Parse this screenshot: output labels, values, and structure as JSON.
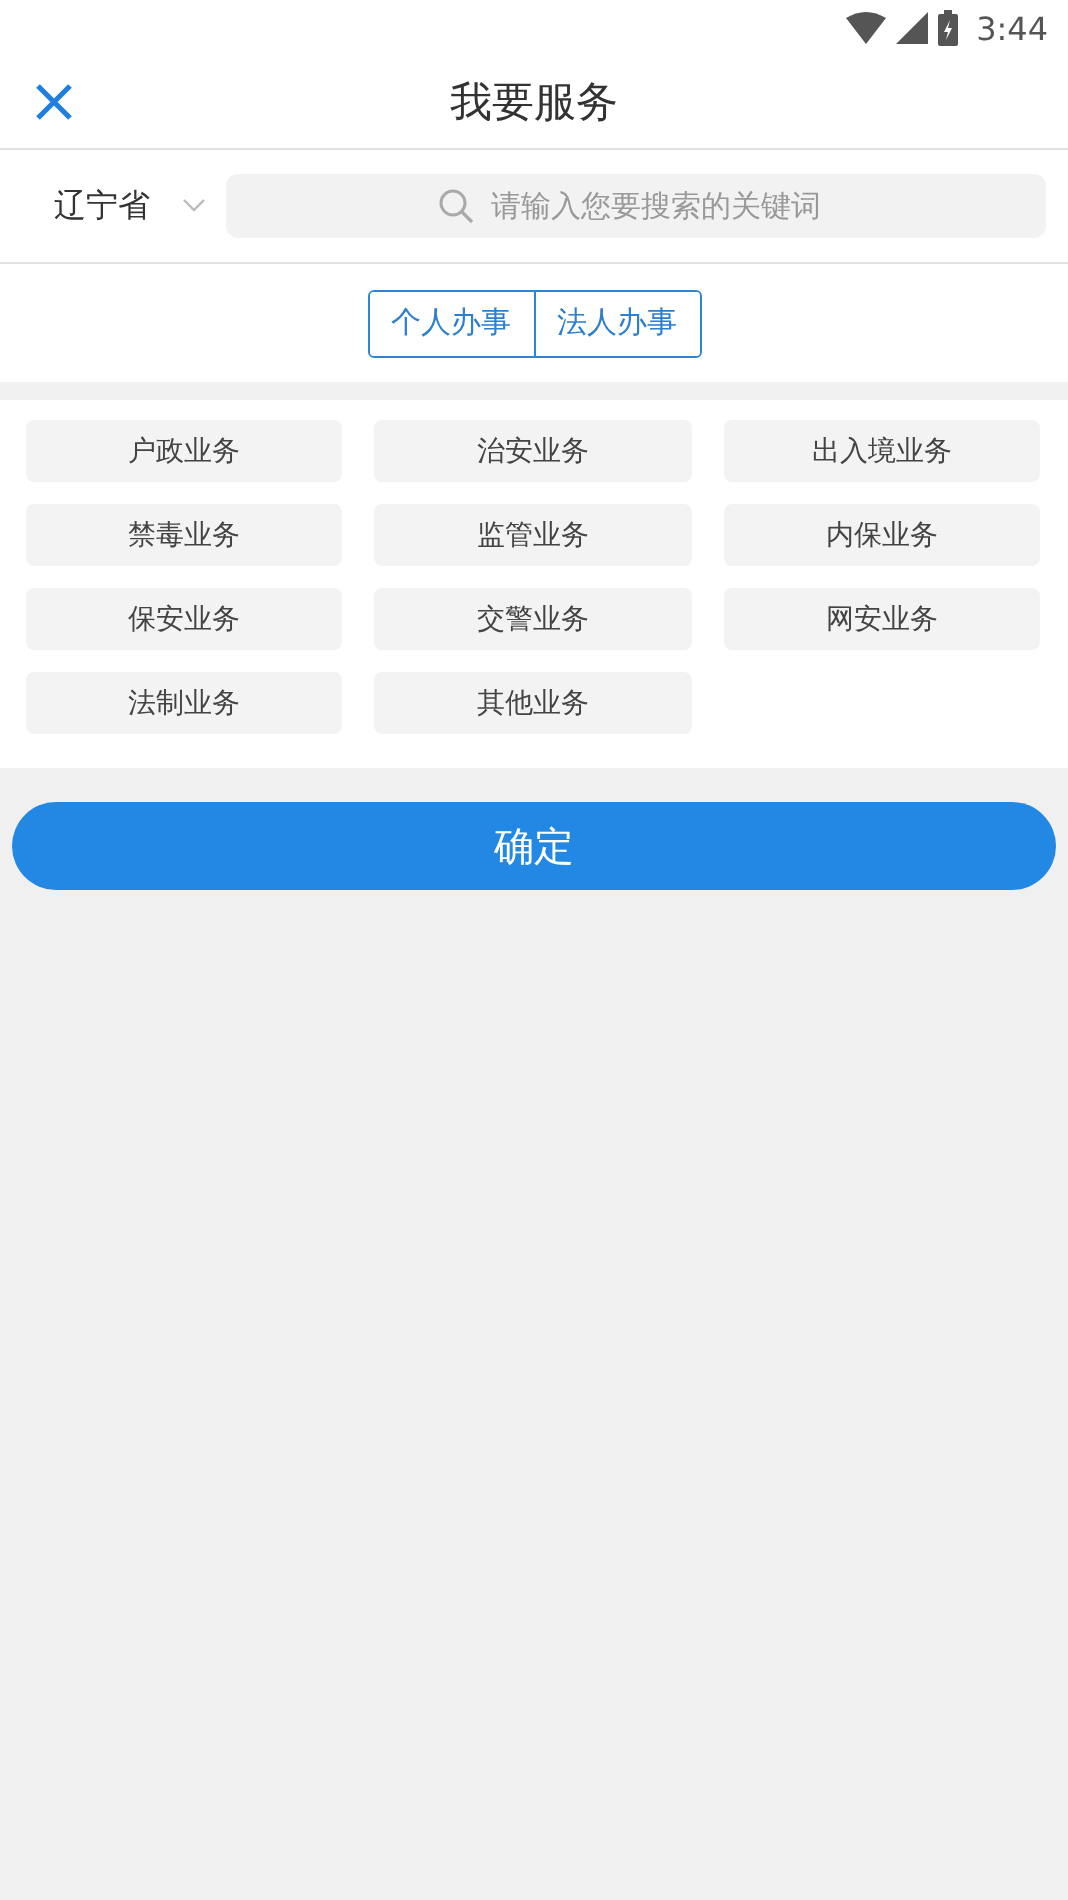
{
  "status_bar": {
    "time": "3:44"
  },
  "header": {
    "title": "我要服务"
  },
  "search_row": {
    "province": "辽宁省",
    "search": {
      "placeholder": "请输入您要搜索的关键词"
    }
  },
  "tabs": [
    {
      "label": "个人办事",
      "selected": false
    },
    {
      "label": "法人办事",
      "selected": false
    }
  ],
  "categories": [
    "户政业务",
    "治安业务",
    "出入境业务",
    "禁毒业务",
    "监管业务",
    "内保业务",
    "保安业务",
    "交警业务",
    "网安业务",
    "法制业务",
    "其他业务"
  ],
  "confirm_button": "确定"
}
